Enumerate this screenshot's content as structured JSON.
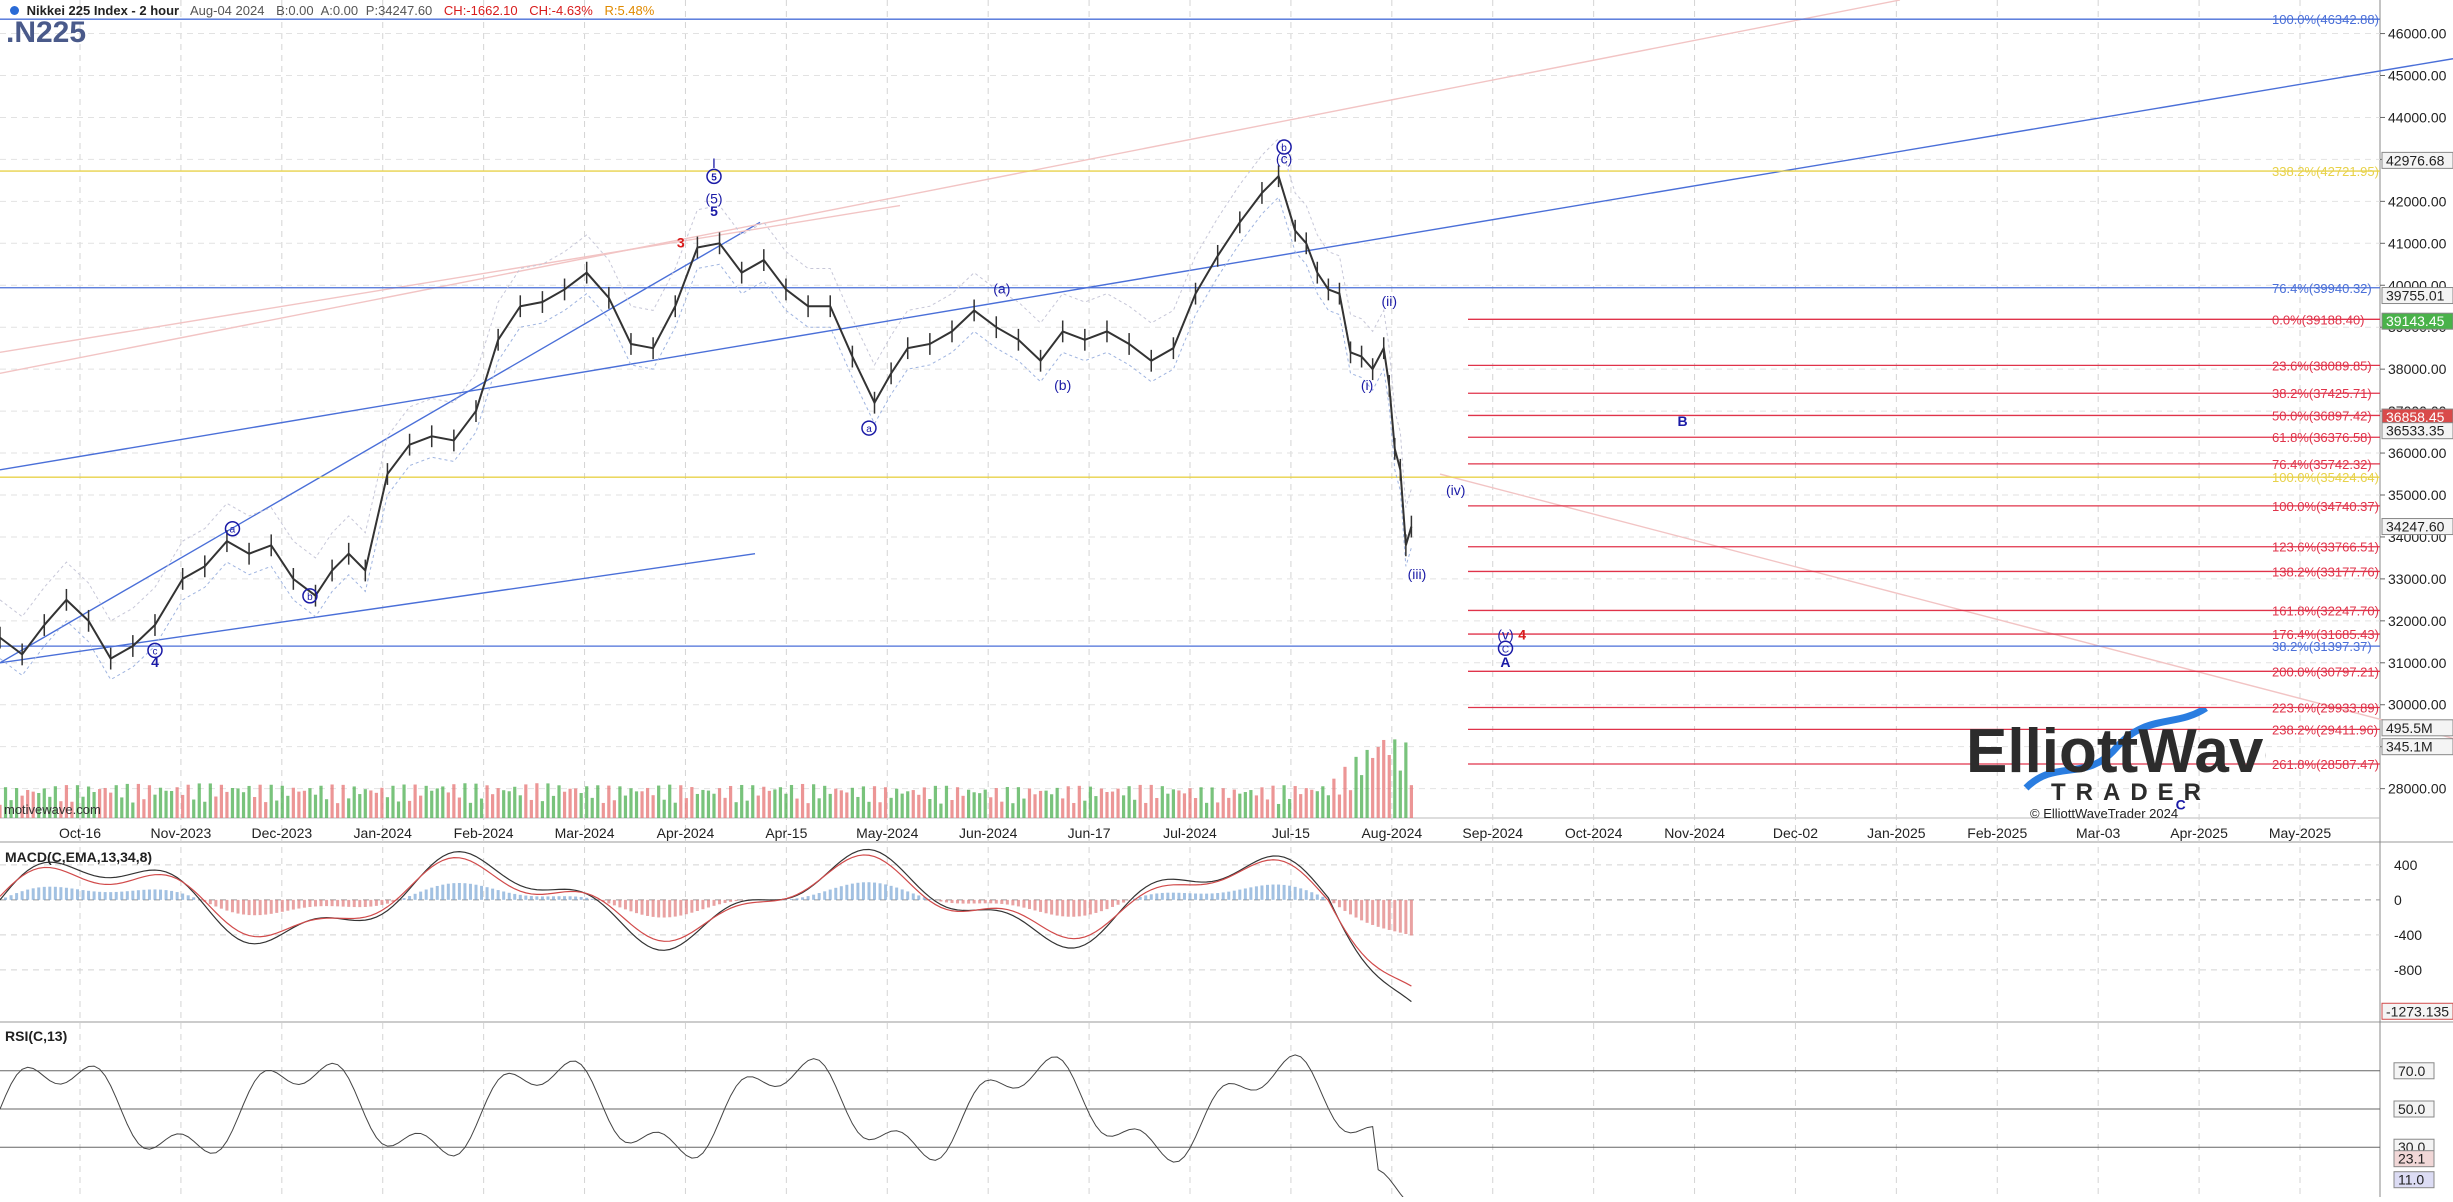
{
  "header": {
    "title": "Nikkei 225 Index - 2 hour",
    "date": "Aug-04 2024",
    "b_value": "B:0.00",
    "a_value": "A:0.00",
    "price": "P:34247.60",
    "change": "CH:-1662.10",
    "change_pct": "CH:-4.63%",
    "range": "R:5.48%",
    "symbol": ".N225"
  },
  "colors": {
    "up_bar": "#4caf50",
    "down_bar": "#e57373",
    "fib_line": "#e0334a",
    "yellow_line": "#e8d24a",
    "blue_line": "#4a6fd8",
    "label_blue": "#1a1aa6",
    "label_red": "#d81b1b"
  },
  "watermark": {
    "brand_top": "ElliottWave",
    "brand_bottom": "TRADER",
    "copyright": "© ElliottWaveTrader 2024",
    "source": "motivewave.com"
  },
  "chart_data": [
    {
      "type": "line",
      "name": "price",
      "x_labels": [
        "Oct-16",
        "Nov-2023",
        "Dec-2023",
        "Jan-2024",
        "Feb-2024",
        "Mar-2024",
        "Apr-2024",
        "Apr-15",
        "May-2024",
        "Jun-2024",
        "Jun-17",
        "Jul-2024",
        "Jul-15",
        "Aug-2024",
        "Sep-2024",
        "Oct-2024",
        "Nov-2024",
        "Dec-02",
        "Jan-2025",
        "Feb-2025",
        "Mar-03",
        "Apr-2025",
        "May-2025"
      ],
      "y_ticks": [
        28000,
        29000,
        30000,
        31000,
        32000,
        33000,
        34000,
        35000,
        36000,
        37000,
        38000,
        39000,
        40000,
        41000,
        42000,
        43000,
        44000,
        45000,
        46000
      ],
      "ylim": [
        27300,
        46800
      ],
      "price_path": [
        [
          0,
          31600
        ],
        [
          4,
          31200
        ],
        [
          8,
          31900
        ],
        [
          12,
          32500
        ],
        [
          16,
          32000
        ],
        [
          20,
          31100
        ],
        [
          24,
          31400
        ],
        [
          28,
          31900
        ],
        [
          33,
          33000
        ],
        [
          37,
          33300
        ],
        [
          41,
          33900
        ],
        [
          45,
          33600
        ],
        [
          49,
          33800
        ],
        [
          53,
          33000
        ],
        [
          57,
          32600
        ],
        [
          60,
          33200
        ],
        [
          63,
          33600
        ],
        [
          66,
          33200
        ],
        [
          70,
          35500
        ],
        [
          74,
          36200
        ],
        [
          78,
          36400
        ],
        [
          82,
          36300
        ],
        [
          86,
          37000
        ],
        [
          90,
          38700
        ],
        [
          94,
          39500
        ],
        [
          98,
          39600
        ],
        [
          102,
          39900
        ],
        [
          106,
          40300
        ],
        [
          110,
          39700
        ],
        [
          114,
          38600
        ],
        [
          118,
          38500
        ],
        [
          122,
          39500
        ],
        [
          126,
          40900
        ],
        [
          130,
          41000
        ],
        [
          134,
          40300
        ],
        [
          138,
          40600
        ],
        [
          142,
          39900
        ],
        [
          146,
          39500
        ],
        [
          150,
          39500
        ],
        [
          154,
          38300
        ],
        [
          158,
          37200
        ],
        [
          161,
          37900
        ],
        [
          164,
          38500
        ],
        [
          168,
          38600
        ],
        [
          172,
          38900
        ],
        [
          176,
          39400
        ],
        [
          180,
          39000
        ],
        [
          184,
          38700
        ],
        [
          188,
          38200
        ],
        [
          192,
          38900
        ],
        [
          196,
          38700
        ],
        [
          200,
          38900
        ],
        [
          204,
          38600
        ],
        [
          208,
          38200
        ],
        [
          212,
          38500
        ],
        [
          216,
          39800
        ],
        [
          220,
          40700
        ],
        [
          224,
          41500
        ],
        [
          228,
          42200
        ],
        [
          231,
          42600
        ],
        [
          234,
          41300
        ],
        [
          236,
          41000
        ],
        [
          238,
          40300
        ],
        [
          240,
          39900
        ],
        [
          242,
          39800
        ],
        [
          244,
          38400
        ],
        [
          246,
          38300
        ],
        [
          248,
          38000
        ],
        [
          250,
          38500
        ],
        [
          251,
          37600
        ],
        [
          252,
          36100
        ],
        [
          253,
          35600
        ],
        [
          254,
          33800
        ],
        [
          255,
          34247
        ]
      ],
      "volume": [
        [
          0,
          0.55
        ],
        [
          10,
          0.58
        ],
        [
          20,
          0.62
        ],
        [
          30,
          0.6
        ],
        [
          40,
          0.63
        ],
        [
          50,
          0.59
        ],
        [
          60,
          0.6
        ],
        [
          70,
          0.58
        ],
        [
          80,
          0.64
        ],
        [
          90,
          0.6
        ],
        [
          100,
          0.63
        ],
        [
          110,
          0.58
        ],
        [
          120,
          0.6
        ],
        [
          130,
          0.57
        ],
        [
          140,
          0.62
        ],
        [
          150,
          0.6
        ],
        [
          160,
          0.56
        ],
        [
          170,
          0.58
        ],
        [
          180,
          0.55
        ],
        [
          190,
          0.57
        ],
        [
          200,
          0.58
        ],
        [
          210,
          0.6
        ],
        [
          220,
          0.54
        ],
        [
          230,
          0.58
        ],
        [
          240,
          0.62
        ],
        [
          250,
          1.6
        ],
        [
          255,
          1.3
        ]
      ],
      "price_tags": [
        {
          "label": "42976.68",
          "value": 42977
        },
        {
          "label": "39755.01",
          "value": 39755
        },
        {
          "label": "39143.45",
          "value": 39143
        },
        {
          "label": "36858.45",
          "value": 36858
        },
        {
          "label": "36533.35",
          "value": 36533
        },
        {
          "label": "34247.60",
          "value": 34248
        },
        {
          "label": "495.5M",
          "value": 29450
        },
        {
          "label": "345.1M",
          "value": 29000
        }
      ],
      "fib_levels": [
        {
          "label": "100.0%(46342.88)",
          "value": 46343,
          "color": "blue"
        },
        {
          "label": "338.2%(42721.95)",
          "value": 42722,
          "color": "yellow"
        },
        {
          "label": "76.4%(39940.32)",
          "value": 39940,
          "color": "blue"
        },
        {
          "label": "0.0%(39188.40)",
          "value": 39188,
          "color": "red"
        },
        {
          "label": "23.6%(38089.85)",
          "value": 38090,
          "color": "red"
        },
        {
          "label": "38.2%(37425.71)",
          "value": 37426,
          "color": "red"
        },
        {
          "label": "50.0%(36897.42)",
          "value": 36897,
          "color": "red"
        },
        {
          "label": "61.8%(36376.58)",
          "value": 36377,
          "color": "red"
        },
        {
          "label": "76.4%(35742.32)",
          "value": 35742,
          "color": "red"
        },
        {
          "label": "100.0%(35424.64)",
          "value": 35425,
          "color": "yellow"
        },
        {
          "label": "100.0%(34740.37)",
          "value": 34740,
          "color": "red"
        },
        {
          "label": "123.6%(33766.51)",
          "value": 33767,
          "color": "red"
        },
        {
          "label": "138.2%(33177.76)",
          "value": 33178,
          "color": "red"
        },
        {
          "label": "161.8%(32247.70)",
          "value": 32248,
          "color": "red"
        },
        {
          "label": "176.4%(31685.43)",
          "value": 31685,
          "color": "red"
        },
        {
          "label": "38.2%(31397.37)",
          "value": 31397,
          "color": "blue"
        },
        {
          "label": "200.0%(30797.21)",
          "value": 30797,
          "color": "red"
        },
        {
          "label": "223.6%(29933.89)",
          "value": 29934,
          "color": "red"
        },
        {
          "label": "238.2%(29411.96)",
          "value": 29412,
          "color": "red"
        },
        {
          "label": "261.8%(28587.47)",
          "value": 28587,
          "color": "red"
        }
      ],
      "wave_labels": [
        {
          "text": "4",
          "bar": 28,
          "value": 30900,
          "color": "blue",
          "bold": true
        },
        {
          "text": "c",
          "bar": 28,
          "value": 31200,
          "color": "blue",
          "circle": true
        },
        {
          "text": "a",
          "bar": 42,
          "value": 34100,
          "color": "blue",
          "circle": true
        },
        {
          "text": "b",
          "bar": 56,
          "value": 32500,
          "color": "blue",
          "circle": true
        },
        {
          "text": "3",
          "bar": 123,
          "value": 40900,
          "color": "red",
          "bold": true
        },
        {
          "text": "I",
          "bar": 129,
          "value": 42800,
          "color": "blue"
        },
        {
          "text": "5",
          "bar": 129,
          "value": 42500,
          "color": "blue",
          "circle": true,
          "bold": true
        },
        {
          "text": "(5)",
          "bar": 129,
          "value": 41950,
          "color": "blue"
        },
        {
          "text": "5",
          "bar": 129,
          "value": 41650,
          "color": "blue",
          "bold": true
        },
        {
          "text": "a",
          "bar": 157,
          "value": 36500,
          "color": "blue",
          "circle": true
        },
        {
          "text": "(a)",
          "bar": 181,
          "value": 39800,
          "color": "blue"
        },
        {
          "text": "(b)",
          "bar": 192,
          "value": 37500,
          "color": "blue"
        },
        {
          "text": "b",
          "bar": 232,
          "value": 43200,
          "color": "blue",
          "circle": true
        },
        {
          "text": "(c)",
          "bar": 232,
          "value": 42900,
          "color": "blue"
        },
        {
          "text": "(ii)",
          "bar": 251,
          "value": 39500,
          "color": "blue"
        },
        {
          "text": "(i)",
          "bar": 247,
          "value": 37500,
          "color": "blue"
        },
        {
          "text": "(iv)",
          "bar": 263,
          "value": 35000,
          "color": "blue"
        },
        {
          "text": "(iii)",
          "bar": 256,
          "value": 33000,
          "color": "blue"
        },
        {
          "text": "(v)",
          "bar": 272,
          "value": 31550,
          "color": "blue"
        },
        {
          "text": "4",
          "bar": 275,
          "value": 31550,
          "color": "red",
          "bold": true
        },
        {
          "text": "C",
          "bar": 272,
          "value": 31250,
          "color": "blue",
          "circle": true
        },
        {
          "text": "A",
          "bar": 272,
          "value": 30900,
          "color": "blue",
          "bold": true
        },
        {
          "text": "B",
          "bar": 304,
          "value": 36650,
          "color": "blue",
          "bold": true
        },
        {
          "text": "C",
          "bar": 394,
          "value": 27500,
          "color": "blue",
          "bold": true
        }
      ]
    },
    {
      "type": "line",
      "name": "MACD(C,EMA,13,34,8)",
      "y_ticks": [
        400,
        0,
        -400,
        -800
      ],
      "ylim": [
        -1350,
        650
      ],
      "last_tag": "-1273.135"
    },
    {
      "type": "line",
      "name": "RSI(C,13)",
      "y_ticks": [
        70.0,
        50.0,
        30.0
      ],
      "ylim": [
        5,
        95
      ],
      "tags": [
        "23.1",
        "11.0"
      ]
    }
  ]
}
